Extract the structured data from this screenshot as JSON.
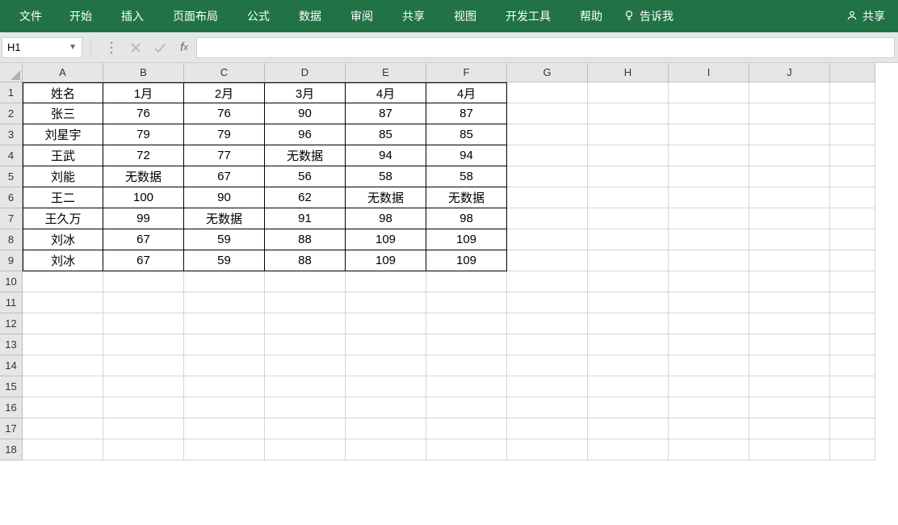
{
  "ribbon": {
    "tabs": [
      "文件",
      "开始",
      "插入",
      "页面布局",
      "公式",
      "数据",
      "审阅",
      "共享",
      "视图",
      "开发工具",
      "帮助"
    ],
    "tell_me": "告诉我",
    "share": "共享"
  },
  "formula_bar": {
    "name_box": "H1",
    "formula_value": ""
  },
  "columns": [
    "A",
    "B",
    "C",
    "D",
    "E",
    "F",
    "G",
    "H",
    "I",
    "J"
  ],
  "row_numbers": [
    "1",
    "2",
    "3",
    "4",
    "5",
    "6",
    "7",
    "8",
    "9",
    "10",
    "11",
    "12",
    "13",
    "14",
    "15",
    "16",
    "17",
    "18"
  ],
  "table": {
    "data_cols": 6,
    "data_rows": 9,
    "rows": [
      [
        "姓名",
        "1月",
        "2月",
        "3月",
        "4月",
        "4月"
      ],
      [
        "张三",
        "76",
        "76",
        "90",
        "87",
        "87"
      ],
      [
        "刘星宇",
        "79",
        "79",
        "96",
        "85",
        "85"
      ],
      [
        "王武",
        "72",
        "77",
        "无数据",
        "94",
        "94"
      ],
      [
        "刘能",
        "无数据",
        "67",
        "56",
        "58",
        "58"
      ],
      [
        "王二",
        "100",
        "90",
        "62",
        "无数据",
        "无数据"
      ],
      [
        "王久万",
        "99",
        "无数据",
        "91",
        "98",
        "98"
      ],
      [
        "刘冰",
        "67",
        "59",
        "88",
        "109",
        "109"
      ],
      [
        "刘冰",
        "67",
        "59",
        "88",
        "109",
        "109"
      ]
    ]
  }
}
